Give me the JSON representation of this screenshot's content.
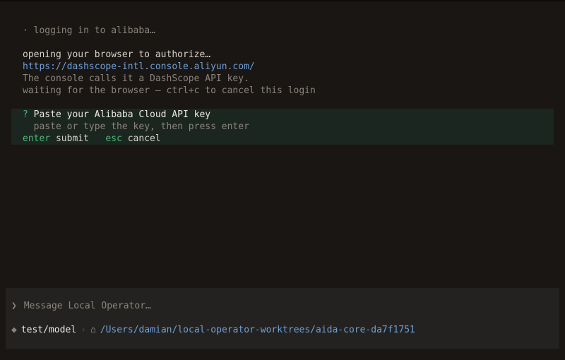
{
  "log": {
    "status_bullet": "·",
    "status_text": "logging in to alibaba…",
    "opening": "opening your browser to authorize…",
    "url": "https://dashscope-intl.console.aliyun.com/",
    "console_note": "The console calls it a DashScope API key.",
    "waiting": "waiting for the browser — ctrl+c to cancel this login"
  },
  "prompt": {
    "marker": "?",
    "question": "Paste your Alibaba Cloud API key",
    "hint": "paste or type the key, then press enter",
    "keys": [
      {
        "key": "enter",
        "action": "submit"
      },
      {
        "key": "esc",
        "action": "cancel"
      }
    ]
  },
  "composer": {
    "chevron": "❯",
    "placeholder": "Message Local Operator…"
  },
  "status_bar": {
    "model_marker": "◆",
    "model": "test/model",
    "separator": "›",
    "home_icon": "⌂",
    "path": "/Users/damian/local-operator-worktrees/aida-core-da7f1751"
  },
  "colors": {
    "background": "#1a1613",
    "accent_green": "#4bb776",
    "link_blue": "#6f9fd8",
    "prompt_bg": "#1c2620",
    "panel_bg": "#242220"
  }
}
